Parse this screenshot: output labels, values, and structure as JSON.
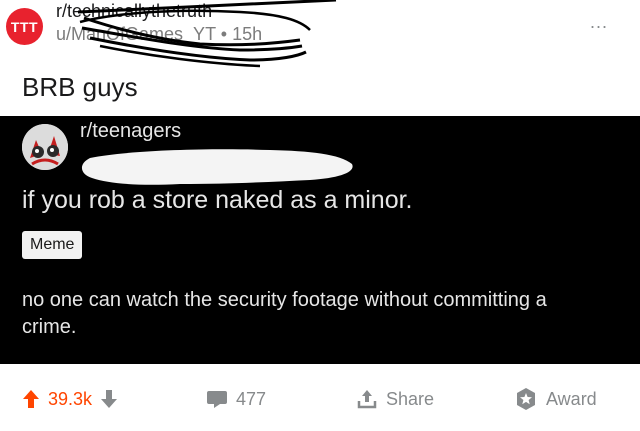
{
  "header": {
    "avatar_text": "TTT",
    "subreddit": "r/technicallythetruth",
    "user": "u/ManOfGames_YT",
    "separator": "•",
    "age": "15h",
    "more": "..."
  },
  "post": {
    "title": "BRB guys"
  },
  "embedded": {
    "subreddit": "r/teenagers",
    "title": "if you rob a store naked as a minor.",
    "flair": "Meme",
    "body": "no one can watch the security footage without committing a crime."
  },
  "footer": {
    "upvotes": "39.3k",
    "comments": "477",
    "share": "Share",
    "award": "Award"
  },
  "colors": {
    "upvote": "#ff4500",
    "avatar_bg": "#e8222e",
    "embed_bg": "#000000",
    "icon_gray": "#878a8c"
  }
}
